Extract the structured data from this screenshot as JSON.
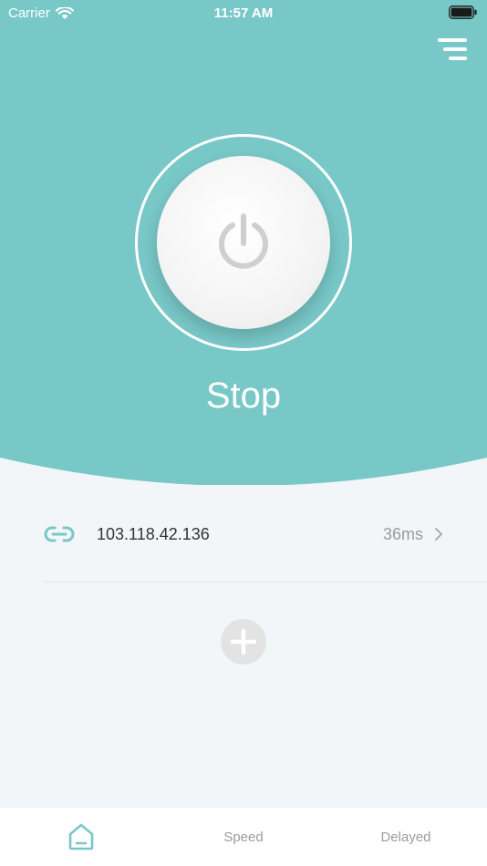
{
  "status_bar": {
    "carrier": "Carrier",
    "time": "11:57 AM"
  },
  "main": {
    "state_label": "Stop",
    "accent_color": "#79c8c8"
  },
  "server": {
    "ip": "103.118.42.136",
    "latency": "36ms",
    "icon": "link-icon"
  },
  "tabs": [
    {
      "label": "",
      "icon": "home-icon",
      "active": true
    },
    {
      "label": "Speed"
    },
    {
      "label": "Delayed"
    }
  ]
}
